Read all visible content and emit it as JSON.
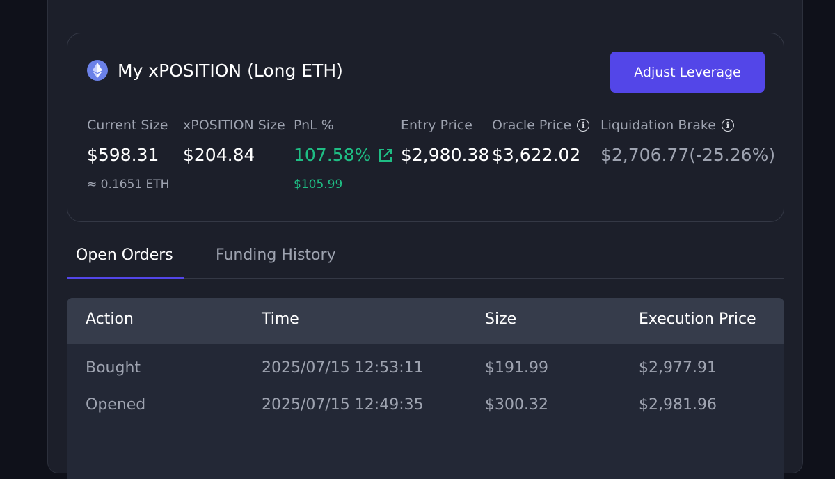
{
  "position": {
    "title": "My xPOSITION (Long ETH)",
    "adjust_label": "Adjust Leverage",
    "icon": "ethereum-icon",
    "stats": {
      "current_size": {
        "label": "Current Size",
        "value": "$598.31",
        "sub": "≈ 0.1651 ETH"
      },
      "xposition_size": {
        "label": "xPOSITION Size",
        "value": "$204.84"
      },
      "pnl": {
        "label": "PnL %",
        "value": "107.58%",
        "sub": "$105.99"
      },
      "entry_price": {
        "label": "Entry Price",
        "value": "$2,980.38"
      },
      "oracle_price": {
        "label": "Oracle Price",
        "value": "$3,622.02"
      },
      "liquidation_brake": {
        "label": "Liquidation Brake",
        "value": "$2,706.77(-25.26%)"
      }
    }
  },
  "tabs": {
    "open_orders": "Open Orders",
    "funding_history": "Funding History"
  },
  "table": {
    "headers": [
      "Action",
      "Time",
      "Size",
      "Execution Price"
    ],
    "rows": [
      {
        "action": "Bought",
        "time": "2025/07/15 12:53:11",
        "size": "$191.99",
        "price": "$2,977.91"
      },
      {
        "action": "Opened",
        "time": "2025/07/15 12:49:35",
        "size": "$300.32",
        "price": "$2,981.96"
      }
    ]
  },
  "colors": {
    "accent": "#5346e8",
    "positive": "#1fbd84",
    "background": "#1c1f2a",
    "muted_text": "#9ea3b0"
  }
}
